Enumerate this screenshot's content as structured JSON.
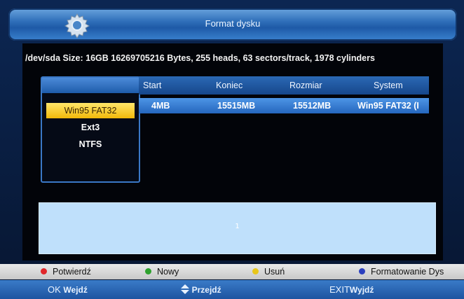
{
  "header": {
    "title": "Format dysku",
    "icon": "gear-icon"
  },
  "device": {
    "info": "/dev/sda Size: 16GB 16269705216 Bytes, 255 heads, 63 sectors/track, 1978 cylinders"
  },
  "filesystems": {
    "items": [
      "Win95 FAT32",
      "Ext3",
      "NTFS"
    ],
    "selected": "Win95 FAT32"
  },
  "table": {
    "columns": [
      "Start",
      "Koniec",
      "Rozmiar",
      "System"
    ],
    "rows": [
      [
        "4MB",
        "15515MB",
        "15512MB",
        "Win95 FAT32 (I"
      ]
    ]
  },
  "info_box": {
    "text": "1"
  },
  "color_keys": [
    {
      "color": "#e0262a",
      "label": "Potwierdź"
    },
    {
      "color": "#2ea12e",
      "label": "Nowy"
    },
    {
      "color": "#e8c61a",
      "label": "Usuń"
    },
    {
      "color": "#2b3fbf",
      "label": "Formatowanie Dys"
    }
  ],
  "nav": {
    "ok_key": "OK",
    "ok_label": "Wejdź",
    "updown_icon": "up-down-arrow-icon",
    "updown_label": "Przejdź",
    "exit_key": "EXIT",
    "exit_label": "Wyjdź"
  }
}
